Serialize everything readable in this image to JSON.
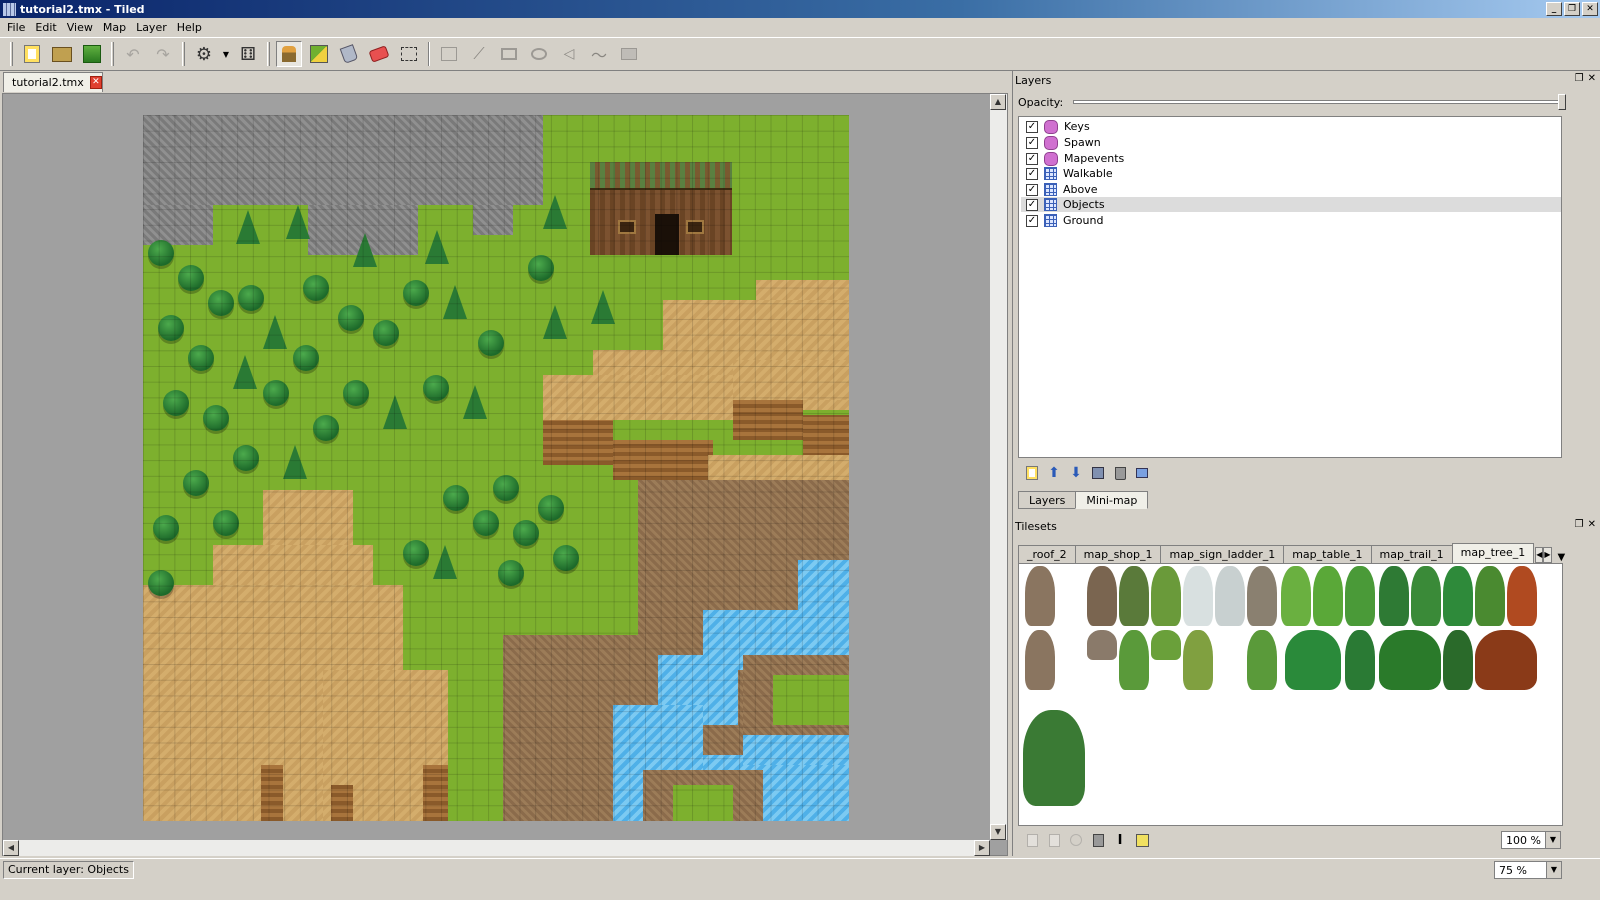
{
  "window": {
    "title": "tutorial2.tmx - Tiled"
  },
  "menu": [
    "File",
    "Edit",
    "View",
    "Map",
    "Layer",
    "Help"
  ],
  "toolbar": {
    "icons": [
      "new-file-icon",
      "open-file-icon",
      "save-icon",
      "undo-icon",
      "redo-icon",
      "command-icon",
      "dice-icon",
      "stamp-brush-icon",
      "terrain-brush-icon",
      "bucket-fill-icon",
      "eraser-icon",
      "rect-select-icon",
      "object-select-icon",
      "edit-polygon-icon",
      "insert-rectangle-icon",
      "insert-ellipse-icon",
      "insert-polygon-icon",
      "insert-polyline-icon",
      "insert-tile-icon"
    ]
  },
  "document": {
    "tab_label": "tutorial2.tmx"
  },
  "layers_panel": {
    "title": "Layers",
    "opacity_label": "Opacity:",
    "opacity_value": 1.0,
    "layers": [
      {
        "name": "Keys",
        "type": "object",
        "visible": true
      },
      {
        "name": "Spawn",
        "type": "object",
        "visible": true
      },
      {
        "name": "Mapevents",
        "type": "object",
        "visible": true
      },
      {
        "name": "Walkable",
        "type": "tile",
        "visible": true
      },
      {
        "name": "Above",
        "type": "tile",
        "visible": true
      },
      {
        "name": "Objects",
        "type": "tile",
        "visible": true,
        "selected": true
      },
      {
        "name": "Ground",
        "type": "tile",
        "visible": true
      }
    ],
    "tabs": [
      "Layers",
      "Mini-map"
    ]
  },
  "tilesets_panel": {
    "title": "Tilesets",
    "tabs": [
      "_roof_2",
      "map_shop_1",
      "map_sign_ladder_1",
      "map_table_1",
      "map_trail_1",
      "map_tree_1"
    ],
    "active_tab": "map_tree_1",
    "zoom": "100 %"
  },
  "status": {
    "current_layer": "Current layer: Objects",
    "zoom": "75 %"
  },
  "colors": {
    "title_start": "#0a246a",
    "title_end": "#a6caf0",
    "grass": "#7db02e",
    "selection": "#dcdcdc"
  }
}
